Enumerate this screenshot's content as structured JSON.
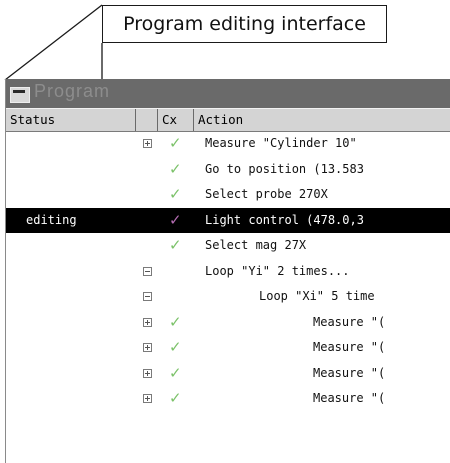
{
  "callout": {
    "label": "Program editing interface"
  },
  "window": {
    "title": "Program",
    "columns": {
      "status": "Status",
      "cx": "Cx",
      "action": "Action"
    },
    "rows": [
      {
        "status": "",
        "expander": "plus",
        "checked": true,
        "indent": 0,
        "action": "Measure \"Cylinder 10\"",
        "selected": false
      },
      {
        "status": "",
        "expander": "",
        "checked": true,
        "indent": 0,
        "action": "Go to position (13.583",
        "selected": false
      },
      {
        "status": "",
        "expander": "",
        "checked": true,
        "indent": 0,
        "action": "Select probe 270X",
        "selected": false
      },
      {
        "status": "editing",
        "expander": "",
        "checked": true,
        "indent": 0,
        "action": "Light control (478.0,3",
        "selected": true
      },
      {
        "status": "",
        "expander": "",
        "checked": true,
        "indent": 0,
        "action": "Select mag 27X",
        "selected": false
      },
      {
        "status": "",
        "expander": "minus",
        "checked": false,
        "indent": 0,
        "action": "Loop \"Yi\" 2 times...",
        "selected": false
      },
      {
        "status": "",
        "expander": "minus",
        "checked": false,
        "indent": 1,
        "action": "Loop \"Xi\" 5 time",
        "selected": false
      },
      {
        "status": "",
        "expander": "plus",
        "checked": true,
        "indent": 2,
        "action": "Measure \"(",
        "selected": false
      },
      {
        "status": "",
        "expander": "plus",
        "checked": true,
        "indent": 2,
        "action": "Measure \"(",
        "selected": false
      },
      {
        "status": "",
        "expander": "plus",
        "checked": true,
        "indent": 2,
        "action": "Measure \"(",
        "selected": false
      },
      {
        "status": "",
        "expander": "plus",
        "checked": true,
        "indent": 2,
        "action": "Measure \"(",
        "selected": false
      }
    ]
  },
  "icons": {
    "check": "check-icon",
    "expand": "expand-icon",
    "collapse": "collapse-icon"
  },
  "colors": {
    "titlebar": "#6a6a6a",
    "header": "#d4d4d4",
    "check": "#7cc26a",
    "selected_row": "#000000"
  }
}
